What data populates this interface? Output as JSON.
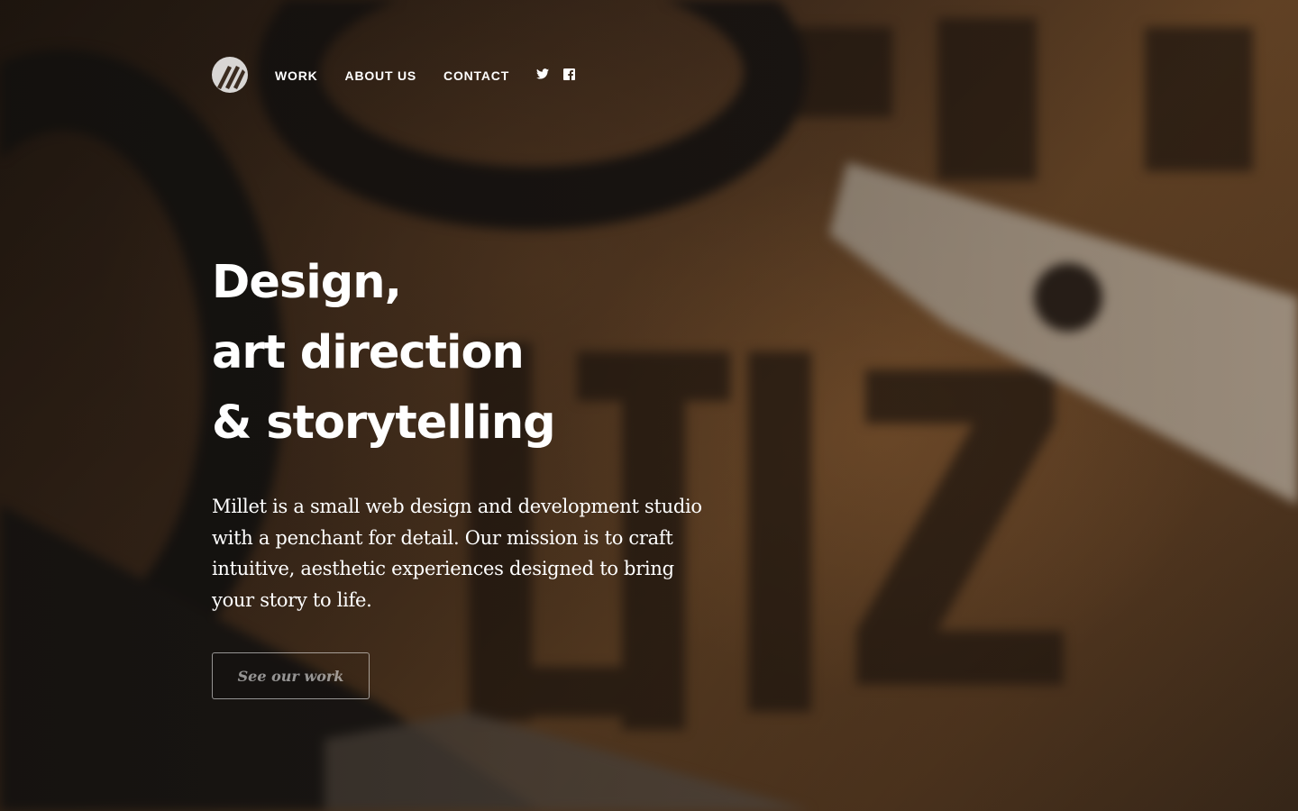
{
  "nav": {
    "logo_icon": "millet-logo-icon",
    "links": [
      {
        "label": "WORK"
      },
      {
        "label": "ABOUT US"
      },
      {
        "label": "CONTACT"
      }
    ],
    "social": [
      {
        "icon": "twitter-icon"
      },
      {
        "icon": "facebook-icon"
      }
    ]
  },
  "hero": {
    "headline_lines": [
      "Design,",
      "art direction",
      "& storytelling"
    ],
    "intro": "Millet is a small web design and development studio with a penchant for detail. Our mission is to craft intuitive, aesthetic experiences designed to bring your story to life.",
    "cta_label": "See our work"
  },
  "colors": {
    "text": "#ffffff",
    "background": "#4a3220"
  }
}
